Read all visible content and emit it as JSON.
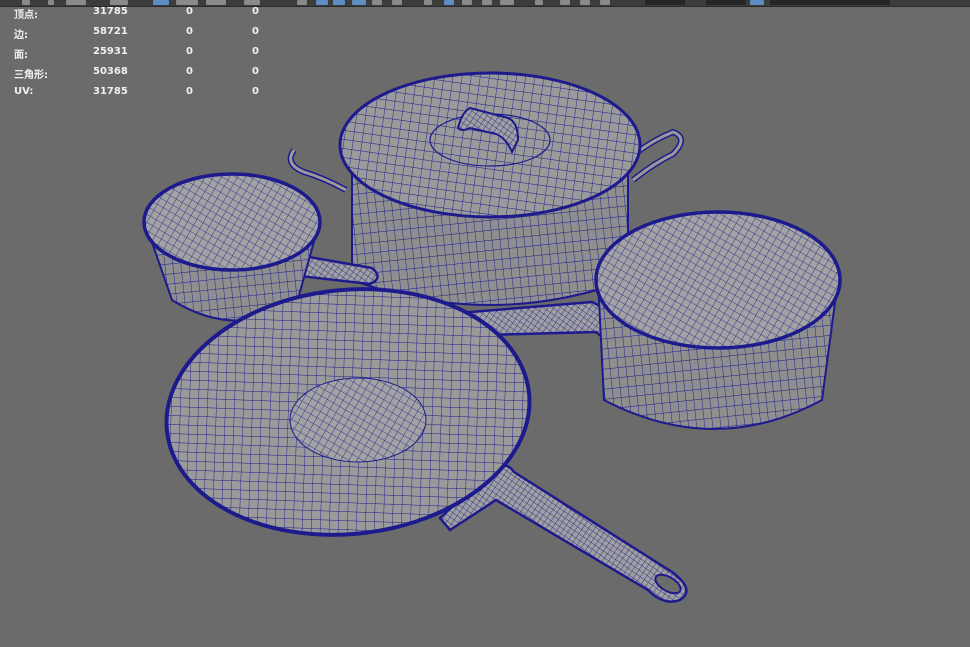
{
  "hud": {
    "rows": [
      {
        "label": "顶点:",
        "v1": "31785",
        "v2": "0",
        "v3": "0"
      },
      {
        "label": "边:",
        "v1": "58721",
        "v2": "0",
        "v3": "0"
      },
      {
        "label": "面:",
        "v1": "25931",
        "v2": "0",
        "v3": "0"
      },
      {
        "label": "三角形:",
        "v1": "50368",
        "v2": "0",
        "v3": "0"
      },
      {
        "label": "UV:",
        "v1": "31785",
        "v2": "0",
        "v3": "0"
      }
    ]
  },
  "colors": {
    "viewport_bg": "#6b6b6b",
    "wire": "#1c1a8c",
    "surface": "#9a9a9a",
    "toolbar": "#3c3c3c"
  }
}
